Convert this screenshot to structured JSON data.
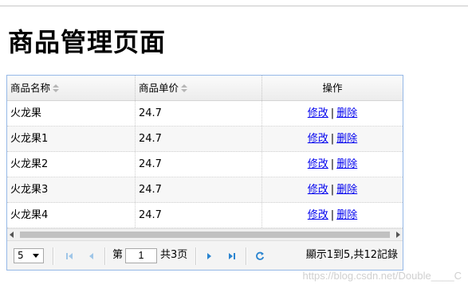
{
  "page": {
    "title": "商品管理页面"
  },
  "table": {
    "columns": [
      {
        "label": "商品名称",
        "sortable": true
      },
      {
        "label": "商品单价",
        "sortable": true
      },
      {
        "label": "操作",
        "sortable": false
      }
    ],
    "rows": [
      {
        "name": "火龙果",
        "price": "24.7",
        "edit": "修改",
        "sep": "|",
        "delete": "删除"
      },
      {
        "name": "火龙果1",
        "price": "24.7",
        "edit": "修改",
        "sep": "|",
        "delete": "删除"
      },
      {
        "name": "火龙果2",
        "price": "24.7",
        "edit": "修改",
        "sep": "|",
        "delete": "删除"
      },
      {
        "name": "火龙果3",
        "price": "24.7",
        "edit": "修改",
        "sep": "|",
        "delete": "删除"
      },
      {
        "name": "火龙果4",
        "price": "24.7",
        "edit": "修改",
        "sep": "|",
        "delete": "删除"
      }
    ]
  },
  "pager": {
    "page_size": "5",
    "page_prefix": "第",
    "current_page": "1",
    "page_suffix": "共3页",
    "info": "顯示1到5,共12記錄",
    "icons": [
      "first-page-icon",
      "prev-page-icon",
      "next-page-icon",
      "last-page-icon",
      "refresh-icon"
    ]
  },
  "watermark": "https://blog.csdn.net/Double____C",
  "colors": {
    "border": "#95b8e7",
    "link": "#0000ee",
    "pager_icon": "#2a84d0"
  }
}
